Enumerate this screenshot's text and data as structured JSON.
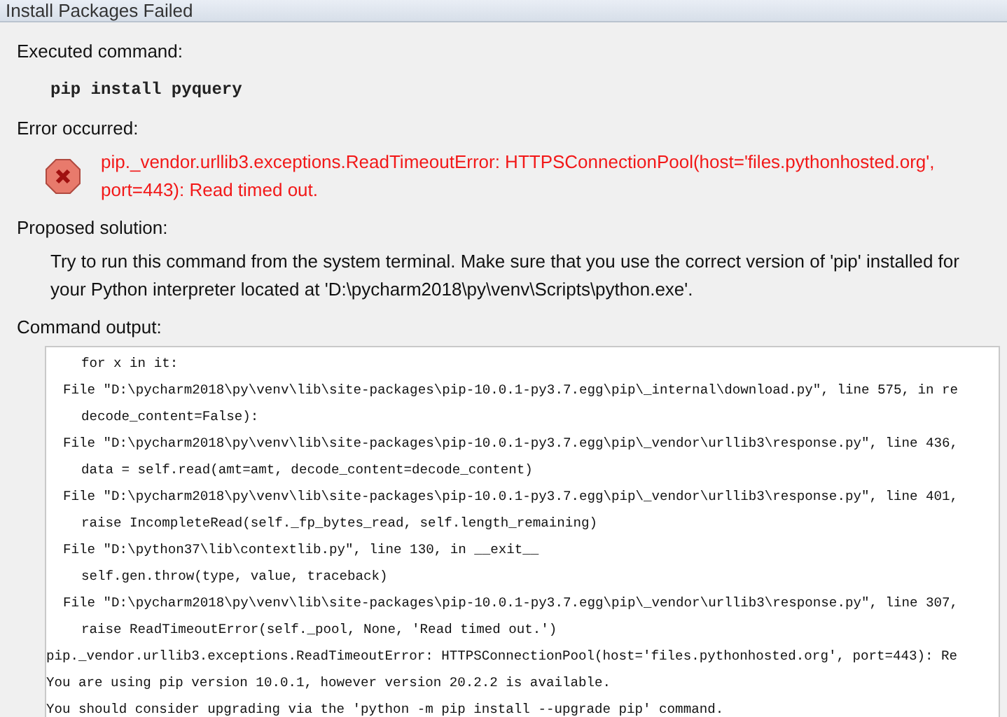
{
  "window": {
    "title": "Install Packages Failed"
  },
  "executed": {
    "label": "Executed command:",
    "command": "pip install pyquery"
  },
  "error": {
    "label": "Error occurred:",
    "message": "pip._vendor.urllib3.exceptions.ReadTimeoutError: HTTPSConnectionPool(host='files.pythonhosted.org', port=443): Read timed out."
  },
  "solution": {
    "label": "Proposed solution:",
    "text": "Try to run this command from the system terminal. Make sure that you use the correct version of 'pip' installed for your Python interpreter located at 'D:\\pycharm2018\\py\\venv\\Scripts\\python.exe'."
  },
  "output": {
    "label": "Command output:",
    "lines": [
      {
        "kind": "code",
        "text": "for x in it:"
      },
      {
        "kind": "frame",
        "text": "File \"D:\\pycharm2018\\py\\venv\\lib\\site-packages\\pip-10.0.1-py3.7.egg\\pip\\_internal\\download.py\", line 575, in re"
      },
      {
        "kind": "code",
        "text": "decode_content=False):"
      },
      {
        "kind": "frame",
        "text": "File \"D:\\pycharm2018\\py\\venv\\lib\\site-packages\\pip-10.0.1-py3.7.egg\\pip\\_vendor\\urllib3\\response.py\", line 436,"
      },
      {
        "kind": "code",
        "text": "data = self.read(amt=amt, decode_content=decode_content)"
      },
      {
        "kind": "frame",
        "text": "File \"D:\\pycharm2018\\py\\venv\\lib\\site-packages\\pip-10.0.1-py3.7.egg\\pip\\_vendor\\urllib3\\response.py\", line 401,"
      },
      {
        "kind": "code",
        "text": "raise IncompleteRead(self._fp_bytes_read, self.length_remaining)"
      },
      {
        "kind": "frame",
        "text": "File \"D:\\python37\\lib\\contextlib.py\", line 130, in __exit__"
      },
      {
        "kind": "code",
        "text": "self.gen.throw(type, value, traceback)"
      },
      {
        "kind": "frame",
        "text": "File \"D:\\pycharm2018\\py\\venv\\lib\\site-packages\\pip-10.0.1-py3.7.egg\\pip\\_vendor\\urllib3\\response.py\", line 307,"
      },
      {
        "kind": "code",
        "text": "raise ReadTimeoutError(self._pool, None, 'Read timed out.')"
      },
      {
        "kind": "plain",
        "text": "pip._vendor.urllib3.exceptions.ReadTimeoutError: HTTPSConnectionPool(host='files.pythonhosted.org', port=443): Re"
      },
      {
        "kind": "plain",
        "text": "You are using pip version 10.0.1, however version 20.2.2 is available."
      },
      {
        "kind": "plain",
        "text": "You should consider upgrading via the 'python -m pip install --upgrade pip' command."
      }
    ]
  }
}
